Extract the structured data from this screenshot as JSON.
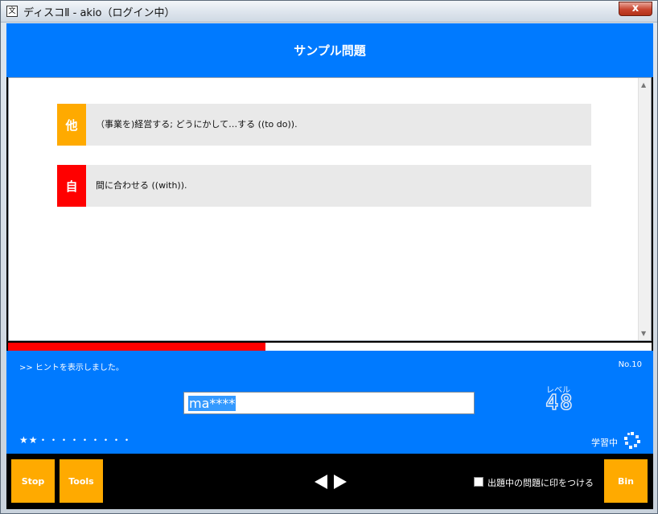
{
  "window": {
    "icon_glyph": "文",
    "title": "ディスコⅡ - akio（ログイン中）",
    "close_glyph": "x"
  },
  "header": {
    "title": "サンプル問題"
  },
  "definitions": [
    {
      "pos": "他",
      "text": "（事業を)経営する; どうにかして…する ((to do))."
    },
    {
      "pos": "自",
      "text": "間に合わせる ((with))."
    }
  ],
  "progress": {
    "fraction": 0.4
  },
  "hint_message": ">> ヒントを表示しました。",
  "question_number": "No.10",
  "answer": {
    "value": "ma****"
  },
  "level": {
    "label": "レベル",
    "value": "48"
  },
  "stars": "★★・・・・・・・・・",
  "status": {
    "label": "学習中"
  },
  "buttons": {
    "stop": "Stop",
    "tools": "Tools",
    "bin": "Bin"
  },
  "mark_checkbox": {
    "label": "出題中の問題に印をつける",
    "checked": false
  },
  "colors": {
    "accent_blue": "#007aff",
    "button_orange": "#ffaa00",
    "transitive_badge": "#ffaa00",
    "intransitive_badge": "#ff0000",
    "progress_red": "#ff0000"
  },
  "icons": {
    "app": "app-icon",
    "close": "close-icon",
    "prev": "triangle-left-icon",
    "next": "triangle-right-icon",
    "status": "diamond-dots-icon",
    "scroll_up": "scroll-up-icon",
    "scroll_down": "scroll-down-icon"
  }
}
